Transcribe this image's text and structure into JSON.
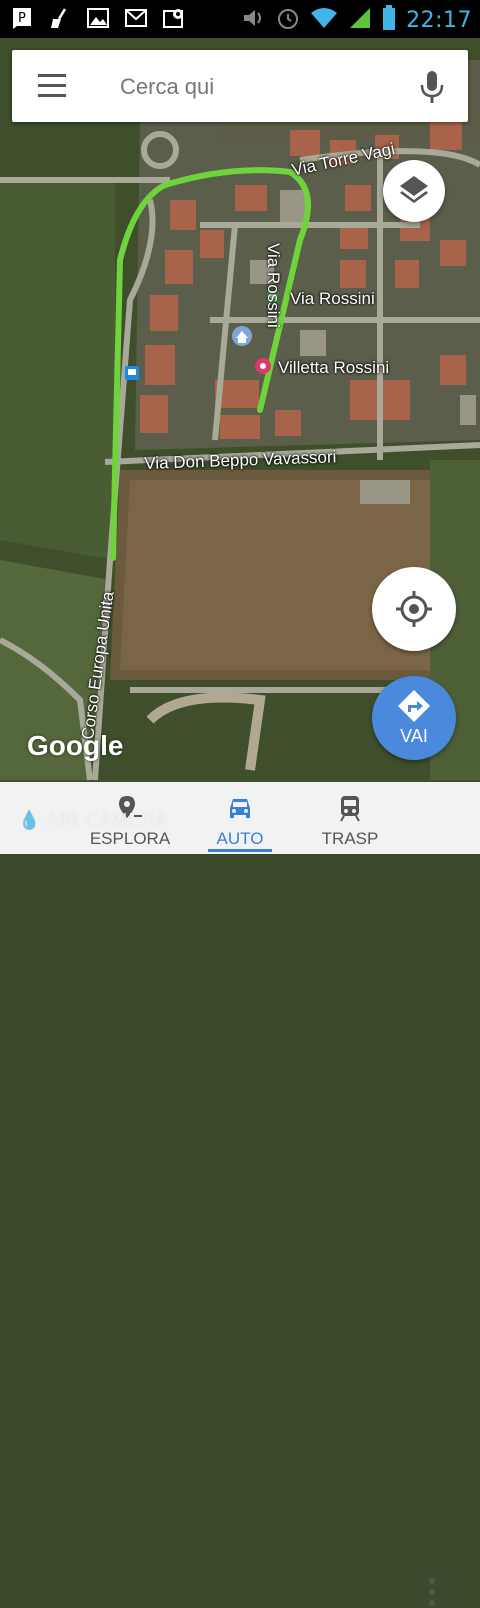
{
  "status_bar": {
    "time": "22:17",
    "left_icons": [
      "pin-notify-icon",
      "broom-icon",
      "image-icon",
      "gmail-icon",
      "map-notify-icon"
    ],
    "right_icons": [
      "volume-icon",
      "alarm-icon",
      "wifi-icon",
      "signal-icon",
      "battery-icon"
    ]
  },
  "search": {
    "placeholder": "Cerca qui"
  },
  "map": {
    "labels": {
      "via_torre": "Via Torre Vagi",
      "via_rossini_vertical": "Via Rossini",
      "via_rossini": "Via Rossini",
      "villetta": "Villetta Rossini",
      "via_don_beppo": "Via Don Beppo Vavassori",
      "corso_europa": "Corso Europa Unita"
    },
    "route_color": "#6fd43c"
  },
  "buttons": {
    "go_label": "VAI"
  },
  "logo": "Google",
  "bottom_nav": [
    {
      "label": "ESPLORA",
      "icon": "explore-pin-icon",
      "active": false
    },
    {
      "label": "AUTO",
      "icon": "car-icon",
      "active": true
    },
    {
      "label": "TRASP",
      "icon": "train-icon",
      "active": false
    }
  ],
  "watermark": "AIR CAMERA",
  "accent_color": "#4a89dc"
}
